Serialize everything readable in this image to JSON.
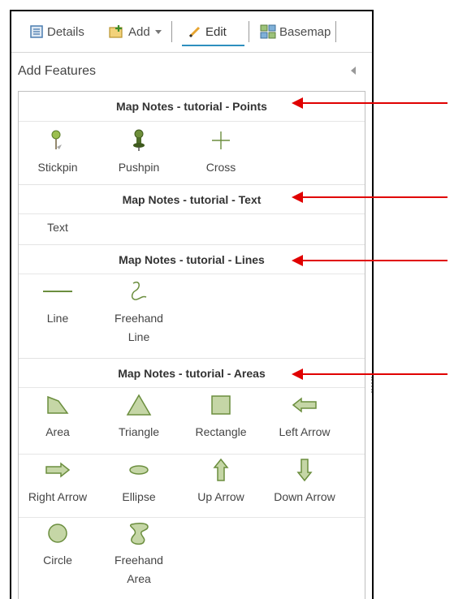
{
  "toolbar": {
    "details_label": "Details",
    "add_label": "Add",
    "edit_label": "Edit",
    "basemap_label": "Basemap"
  },
  "panel": {
    "title": "Add Features"
  },
  "sections": [
    {
      "title": "Map Notes - tutorial - Points",
      "tools": [
        {
          "label": "Stickpin",
          "icon": "stickpin-icon"
        },
        {
          "label": "Pushpin",
          "icon": "pushpin-icon"
        },
        {
          "label": "Cross",
          "icon": "cross-icon"
        }
      ]
    },
    {
      "title": "Map Notes - tutorial - Text",
      "tools": [
        {
          "label": "Text",
          "icon": "text-icon"
        }
      ]
    },
    {
      "title": "Map Notes - tutorial - Lines",
      "tools": [
        {
          "label": "Line",
          "icon": "line-icon"
        },
        {
          "label": "Freehand Line",
          "icon": "freehand-line-icon"
        }
      ]
    },
    {
      "title": "Map Notes - tutorial - Areas",
      "tools": [
        {
          "label": "Area",
          "icon": "area-icon"
        },
        {
          "label": "Triangle",
          "icon": "triangle-icon"
        },
        {
          "label": "Rectangle",
          "icon": "rectangle-icon"
        },
        {
          "label": "Left Arrow",
          "icon": "left-arrow-icon"
        },
        {
          "label": "Right Arrow",
          "icon": "right-arrow-icon"
        },
        {
          "label": "Ellipse",
          "icon": "ellipse-icon"
        },
        {
          "label": "Up Arrow",
          "icon": "up-arrow-icon"
        },
        {
          "label": "Down Arrow",
          "icon": "down-arrow-icon"
        },
        {
          "label": "Circle",
          "icon": "circle-icon"
        },
        {
          "label": "Freehand Area",
          "icon": "freehand-area-icon"
        }
      ]
    }
  ],
  "colors": {
    "symbol_fill": "#c5d6a6",
    "symbol_stroke": "#6b8e3e",
    "annotation_arrow": "#e00000",
    "active_tab_underline": "#2e8fbf"
  }
}
